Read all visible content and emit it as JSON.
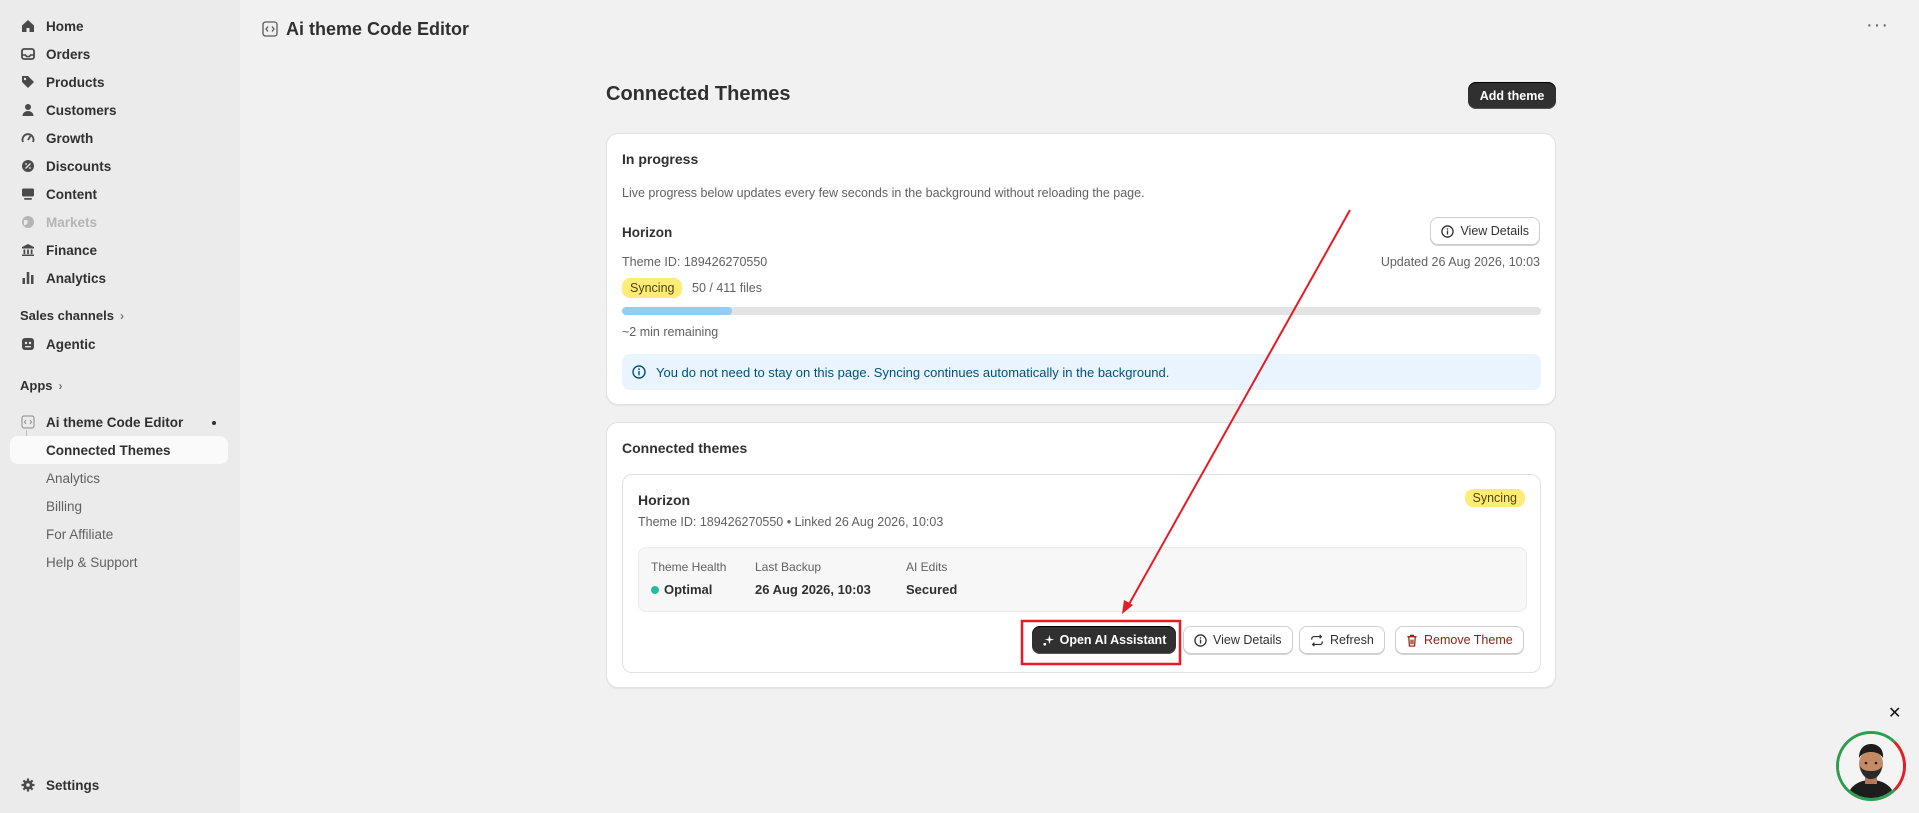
{
  "sidebar": {
    "items": [
      {
        "label": "Home",
        "icon": "home-icon"
      },
      {
        "label": "Orders",
        "icon": "inbox-icon"
      },
      {
        "label": "Products",
        "icon": "tag-icon"
      },
      {
        "label": "Customers",
        "icon": "person-icon"
      },
      {
        "label": "Growth",
        "icon": "gauge-icon"
      },
      {
        "label": "Discounts",
        "icon": "discount-icon"
      },
      {
        "label": "Content",
        "icon": "content-icon"
      },
      {
        "label": "Markets",
        "icon": "globe-icon"
      },
      {
        "label": "Finance",
        "icon": "bank-icon"
      },
      {
        "label": "Analytics",
        "icon": "bar-chart-icon"
      }
    ],
    "sales_channels_label": "Sales channels",
    "agentic_label": "Agentic",
    "apps_label": "Apps",
    "app_name": "Ai theme Code Editor",
    "app_subitems": [
      "Connected Themes",
      "Analytics",
      "Billing",
      "For Affiliate",
      "Help & Support"
    ],
    "settings_label": "Settings"
  },
  "header": {
    "title": "Ai theme Code Editor"
  },
  "page": {
    "title": "Connected Themes",
    "add_theme_label": "Add theme"
  },
  "progress_card": {
    "title": "In progress",
    "description": "Live progress below updates every few seconds in the background without reloading the page.",
    "theme_name": "Horizon",
    "view_details_label": "View Details",
    "theme_id": "Theme ID: 189426270550",
    "updated": "Updated 26 Aug 2026, 10:03",
    "status_badge": "Syncing",
    "files_progress": "50 / 411 files",
    "progress_fraction": 0.12,
    "remaining": "~2 min remaining",
    "notice": "You do not need to stay on this page. Syncing continues automatically in the background."
  },
  "connected_card": {
    "title": "Connected themes",
    "theme_name": "Horizon",
    "status_badge": "Syncing",
    "meta": "Theme ID: 189426270550 • Linked 26 Aug 2026, 10:03",
    "stats": [
      {
        "label": "Theme Health",
        "value": "Optimal"
      },
      {
        "label": "Last Backup",
        "value": "26 Aug 2026, 10:03"
      },
      {
        "label": "AI Edits",
        "value": "Secured"
      }
    ],
    "actions": {
      "open_ai": "Open AI Assistant",
      "view_details": "View Details",
      "refresh": "Refresh",
      "remove": "Remove Theme"
    }
  },
  "colors": {
    "accent_red": "#e51c23",
    "progress_fill": "#91cdf6",
    "health_dot": "#29bc9b",
    "remove_red": "#8e1f0b",
    "notice_bg": "#eaf4ff"
  }
}
